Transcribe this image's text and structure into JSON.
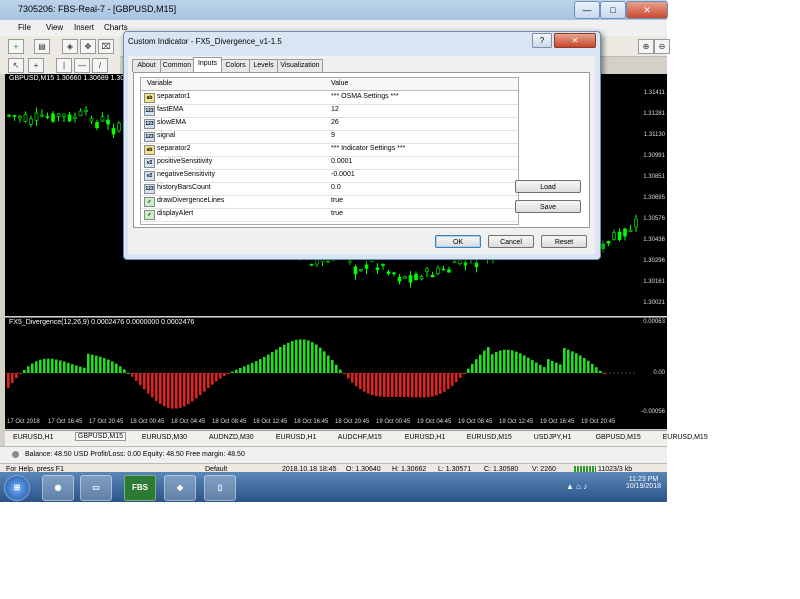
{
  "window": {
    "title": "7305206: FBS-Real-7 - [GBPUSD,M15]"
  },
  "menu": [
    "File",
    "View",
    "Insert",
    "Charts"
  ],
  "dialog": {
    "title": "Custom Indicator - FX5_Divergence_v1-1.5",
    "help_label": "?",
    "close_label": "✕",
    "tabs": [
      "About",
      "Common",
      "Inputs",
      "Colors",
      "Levels",
      "Visualization"
    ],
    "columns": [
      "Variable",
      "Value"
    ],
    "rows": [
      {
        "icon": "ab",
        "name": "separator1",
        "value": "*** OSMA Settings ***"
      },
      {
        "icon": "123",
        "name": "fastEMA",
        "value": "12"
      },
      {
        "icon": "123",
        "name": "slowEMA",
        "value": "26"
      },
      {
        "icon": "123",
        "name": "signal",
        "value": "9"
      },
      {
        "icon": "ab",
        "name": "separator2",
        "value": "*** Indicator Settings ***"
      },
      {
        "icon": "v2",
        "name": "positiveSensitivity",
        "value": "0.0001"
      },
      {
        "icon": "v2",
        "name": "negativeSensitivity",
        "value": "-0.0001"
      },
      {
        "icon": "123",
        "name": "historyBarsCount",
        "value": "0.0"
      },
      {
        "icon": "✓",
        "name": "drawDivergenceLines",
        "value": "true"
      },
      {
        "icon": "✓",
        "name": "displayAlert",
        "value": "true"
      }
    ],
    "load_label": "Load",
    "save_label": "Save",
    "ok_label": "OK",
    "cancel_label": "Cancel",
    "reset_label": "Reset"
  },
  "chart1": {
    "header": "GBPUSD,M15  1.30660 1.30689 1.30",
    "prices": [
      "1.31411",
      "1.31281",
      "1.31130",
      "1.30991",
      "1.30851",
      "1.30695",
      "1.30576",
      "1.30436",
      "1.30296",
      "1.30161",
      "1.30021"
    ]
  },
  "chart2": {
    "header": "FX5_Divergence(12,26,9) 0.0002476 0.0000000 0.0002476",
    "levels": [
      "0.00063",
      "0.00",
      "-0.00056"
    ]
  },
  "time_axis": [
    "17 Oct 2018",
    "17 Oct 16:45",
    "17 Oct 20:45",
    "18 Oct 00:45",
    "18 Oct 04:45",
    "18 Oct 08:45",
    "18 Oct 12:45",
    "18 Oct 16:45",
    "18 Oct 20:45",
    "19 Oct 00:45",
    "19 Oct 04:45",
    "19 Oct 08:45",
    "19 Oct 12:45",
    "19 Oct 16:45",
    "19 Oct 20:45"
  ],
  "symbol_tabs": [
    "EURUSD,H1",
    "GBPUSD,M15",
    "EURUSD,M30",
    "AUDNZD,M30",
    "EURUSD,H1",
    "AUDCHF,M15",
    "EURUSD,H1",
    "EURUSD,M15",
    "USDJPY,H1",
    "GBPUSD,M15",
    "EURUSD,M15"
  ],
  "balance": "Balance: 48.50 USD  Profit/Loss: 0.00  Equity: 48.50  Free margin: 48.50",
  "status": {
    "help": "For Help, press F1",
    "profile": "Default",
    "datetime": "2018.10.18 18:45",
    "open": "O: 1.30640",
    "high": "H: 1.30662",
    "low": "L: 1.30571",
    "close": "C: 1.30580",
    "volume": "V: 2260",
    "traffic": "11023/3 kb"
  },
  "taskbar": {
    "fbs_label": "FBS",
    "time": "11:23 PM",
    "date": "10/19/2018"
  },
  "colors": {
    "bull": "#00ff00",
    "bear": "#ff2020",
    "osma_up": "#22dd22",
    "osma_down": "#dd2222"
  }
}
